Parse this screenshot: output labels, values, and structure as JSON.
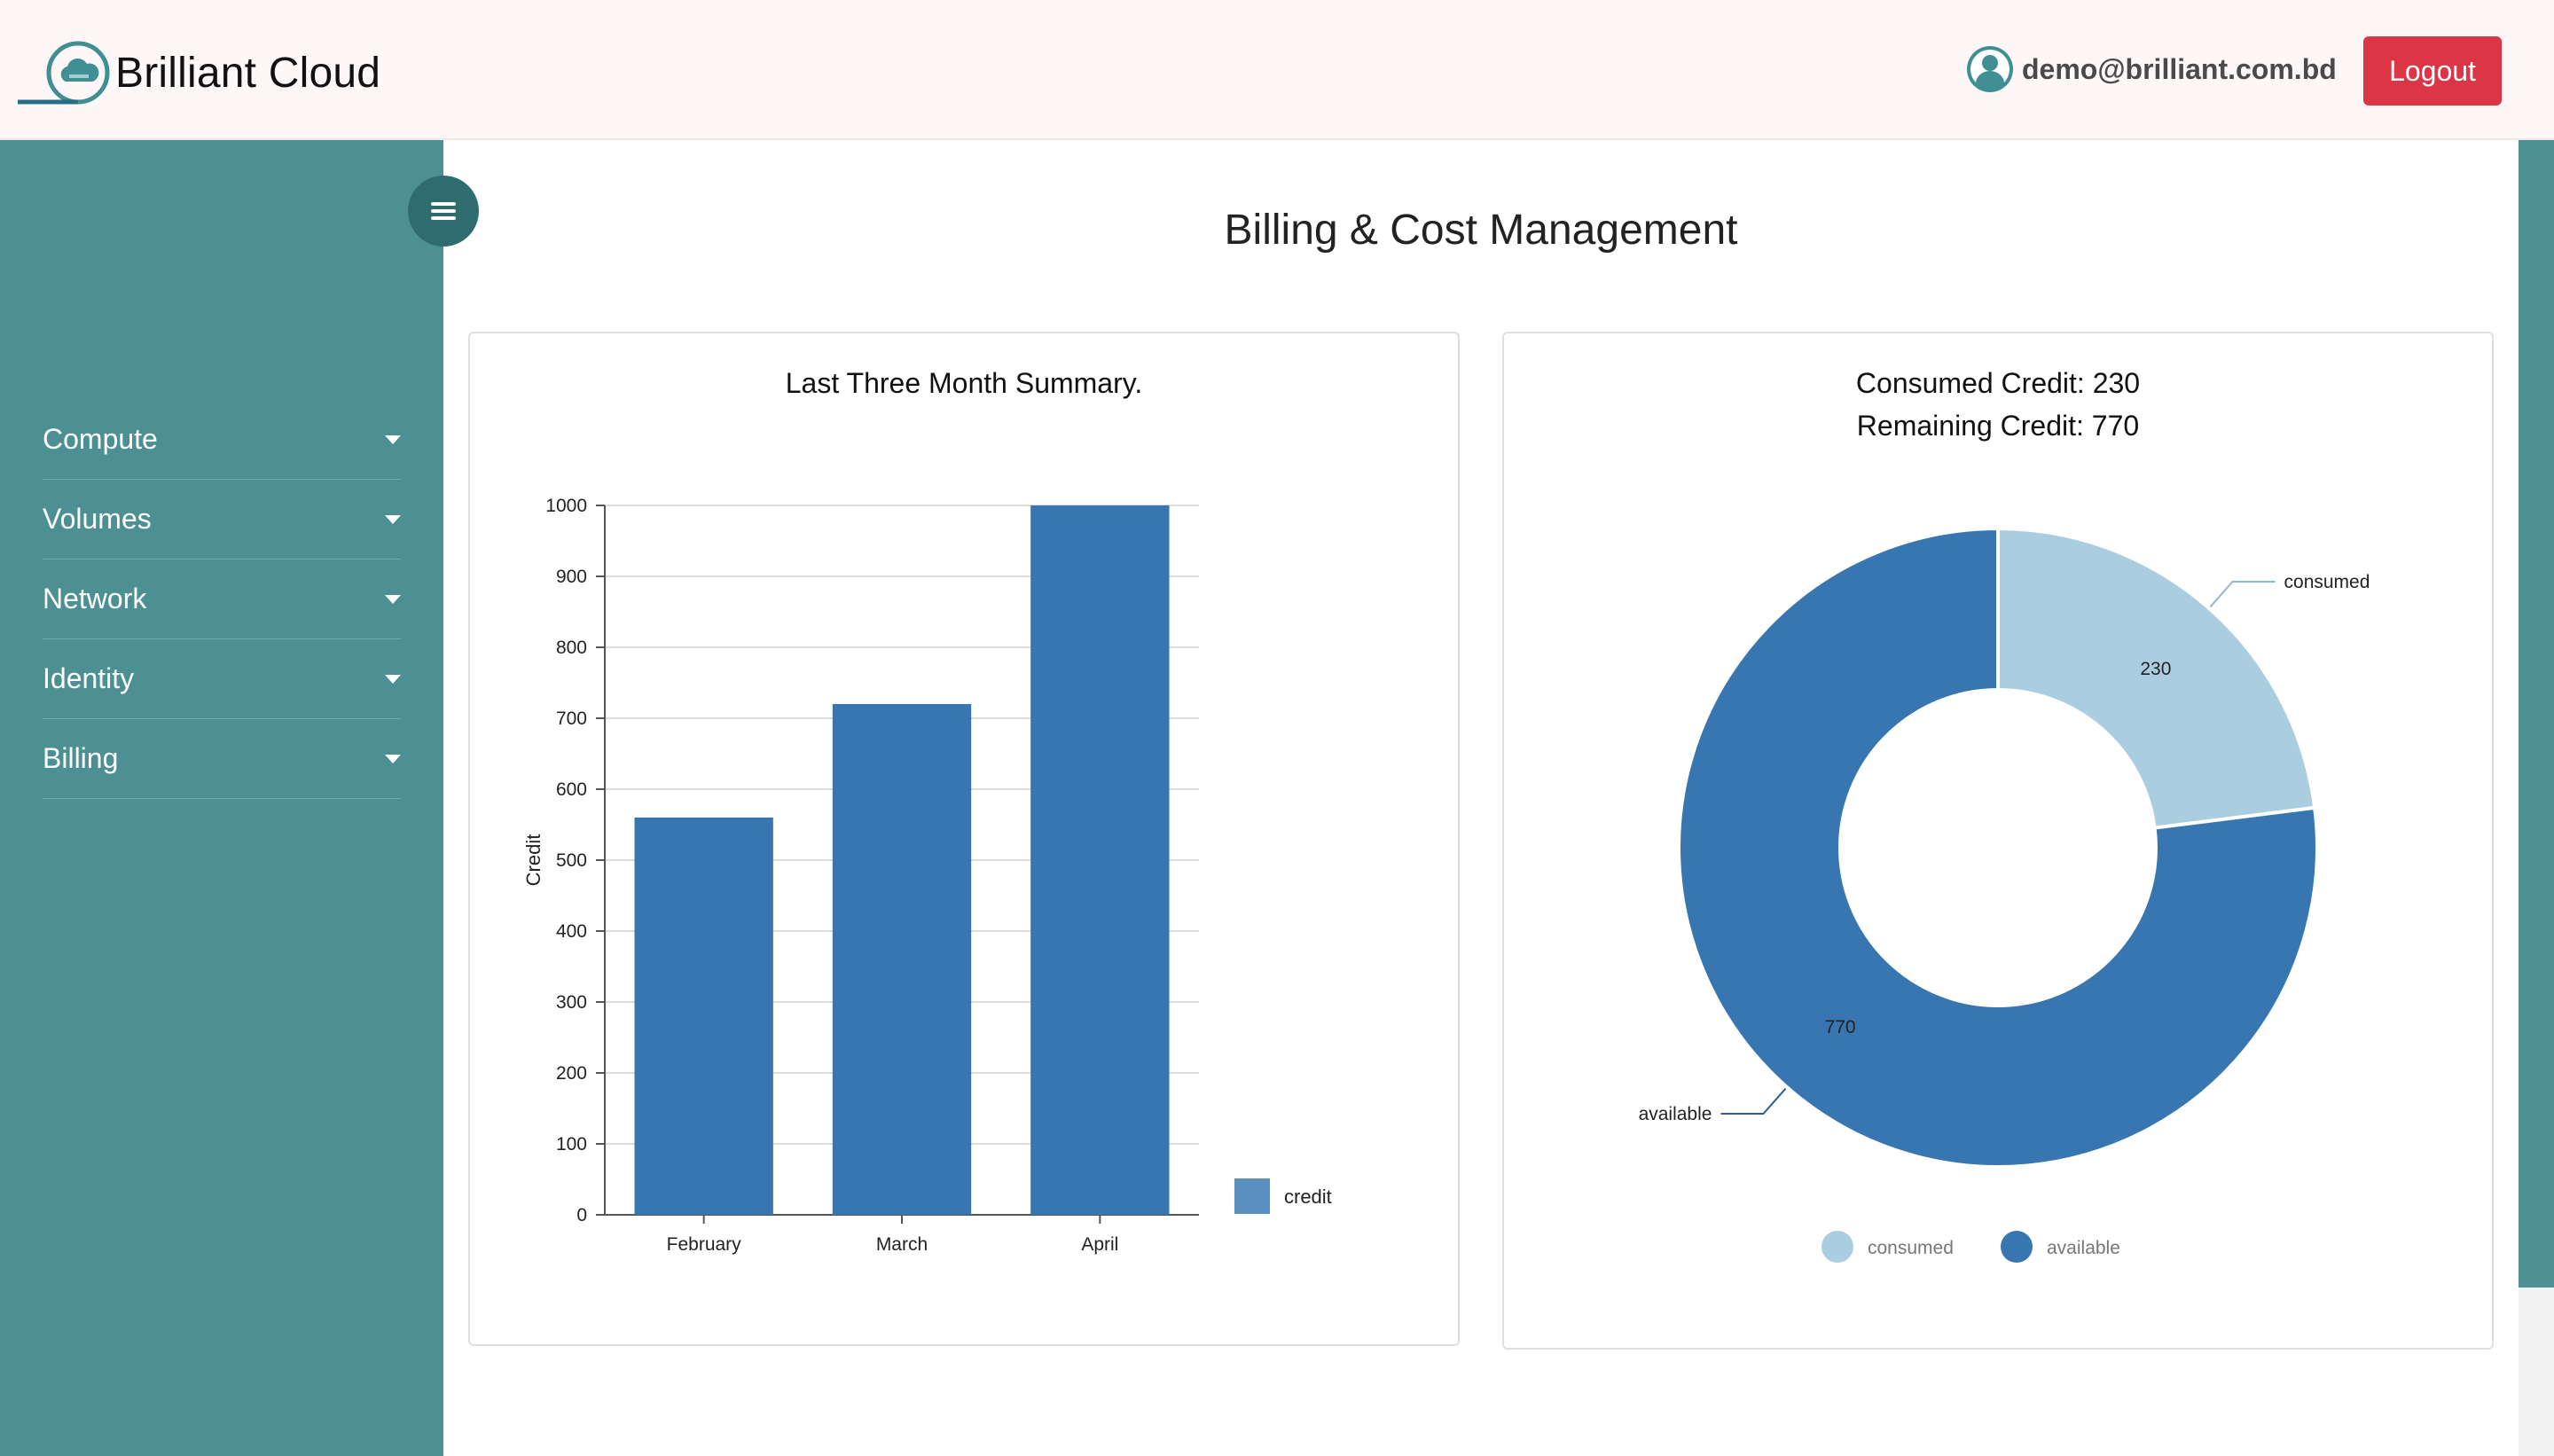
{
  "app": {
    "name": "Brilliant Cloud"
  },
  "header": {
    "user_email": "demo@brilliant.com.bd",
    "logout_label": "Logout"
  },
  "sidebar": {
    "items": [
      {
        "label": "Compute"
      },
      {
        "label": "Volumes"
      },
      {
        "label": "Network"
      },
      {
        "label": "Identity"
      },
      {
        "label": "Billing"
      }
    ]
  },
  "main": {
    "title": "Billing & Cost Management",
    "consumed_line": "Consumed Credit: 230",
    "remaining_line": "Remaining Credit: 770"
  },
  "colors": {
    "bar": "#3776b0",
    "consumed": "#abcde0",
    "available": "#3776b0",
    "sidebar": "#4d9093",
    "logout": "#dc3545"
  },
  "icons": {
    "menu_toggle": "hamburger-icon",
    "user": "user-avatar-icon",
    "logo": "cloud-logo-icon",
    "dropdown": "caret-down-icon"
  },
  "chart_data": [
    {
      "type": "bar",
      "title": "Last Three Month Summary.",
      "categories": [
        "February",
        "March",
        "April"
      ],
      "series": [
        {
          "name": "credit",
          "values": [
            560,
            720,
            1000
          ]
        }
      ],
      "ylabel": "Credit",
      "xlabel": "",
      "ylim": [
        0,
        1000
      ],
      "yticks": [
        0,
        100,
        200,
        300,
        400,
        500,
        600,
        700,
        800,
        900,
        1000
      ],
      "grid": true,
      "legend": "right"
    },
    {
      "type": "pie",
      "variant": "donut",
      "title": "",
      "slices": [
        {
          "label": "consumed",
          "value": 230
        },
        {
          "label": "available",
          "value": 770
        }
      ],
      "legend": "bottom"
    }
  ]
}
